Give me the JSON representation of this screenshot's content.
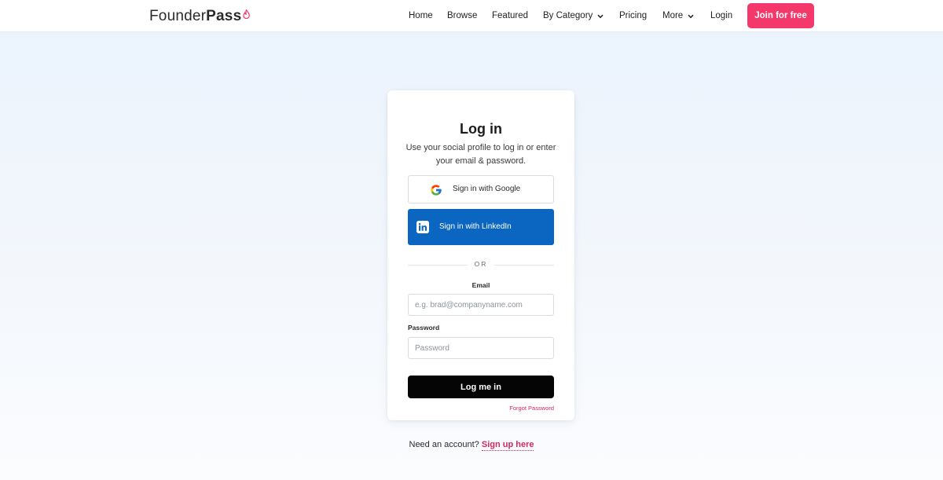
{
  "header": {
    "logo_light": "Founder",
    "logo_bold": "Pass",
    "nav": {
      "home": "Home",
      "browse": "Browse",
      "featured": "Featured",
      "by_category": "By Category",
      "pricing": "Pricing",
      "more": "More",
      "login": "Login"
    },
    "join_label": "Join for free",
    "icons": {
      "logo_mark": "flame-icon",
      "dropdown": "chevron-down-icon"
    }
  },
  "login_card": {
    "title": "Log in",
    "subtitle": "Use your social profile to log in or enter your email & password.",
    "google_label": "Sign in with Google",
    "linkedin_label": "Sign in with LinkedIn",
    "divider_text": "OR",
    "email_label": "Email",
    "email_placeholder": "e.g. brad@companyname.com",
    "email_value": "",
    "password_label": "Password",
    "password_placeholder": "Password",
    "password_value": "",
    "submit_label": "Log me in",
    "forgot_label": "Forgot Password",
    "icons": {
      "google": "google-icon",
      "linkedin": "linkedin-icon"
    }
  },
  "footer": {
    "prompt": "Need an account?",
    "signup_link": "Sign up here"
  },
  "colors": {
    "accent": "#f5386b",
    "link": "#d6275c",
    "linkedin": "#0b66c2",
    "primary_button": "#050505"
  }
}
